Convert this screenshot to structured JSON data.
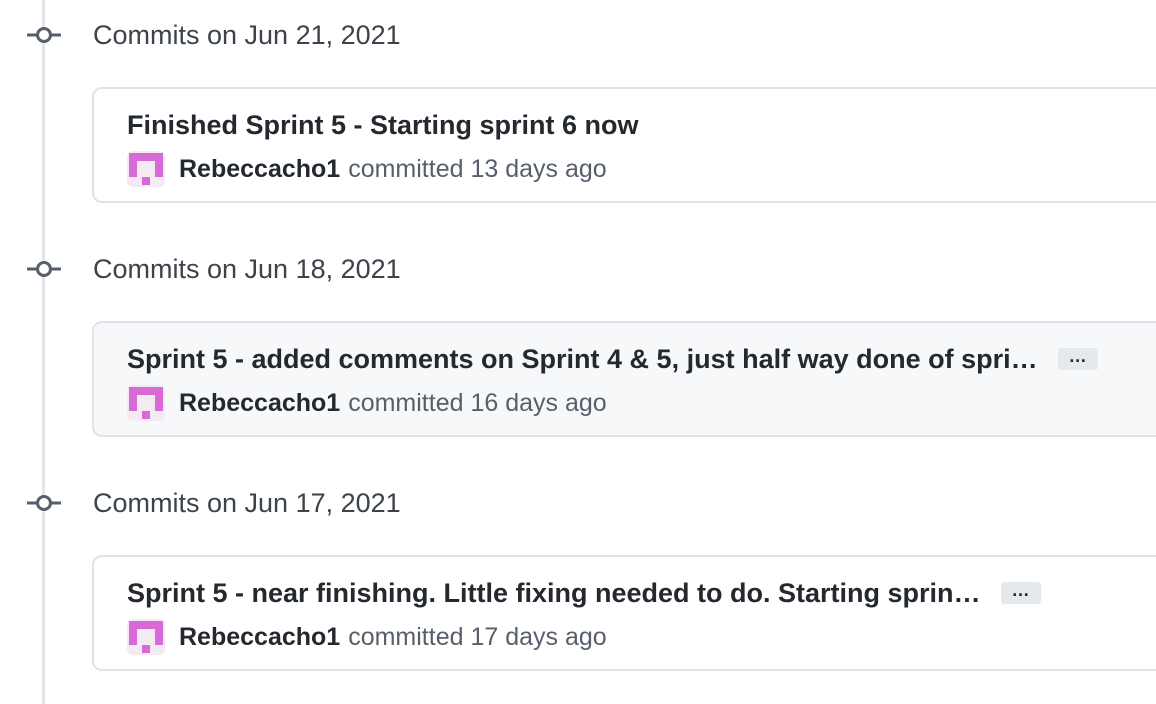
{
  "commit_groups": [
    {
      "date": "Commits on Jun 21, 2021",
      "commits": [
        {
          "title": "Finished Sprint 5 - Starting sprint 6 now",
          "has_ellipsis": false,
          "ellipsis_label": "",
          "author": "Rebeccacho1",
          "committed_text": "committed 13 days ago"
        }
      ]
    },
    {
      "date": "Commits on Jun 18, 2021",
      "commits": [
        {
          "title": "Sprint 5 - added comments on Sprint 4 & 5, just half way done of spri…",
          "has_ellipsis": true,
          "ellipsis_label": "…",
          "author": "Rebeccacho1",
          "committed_text": "committed 16 days ago"
        }
      ]
    },
    {
      "date": "Commits on Jun 17, 2021",
      "commits": [
        {
          "title": "Sprint 5 - near finishing. Little fixing needed to do. Starting sprin…",
          "has_ellipsis": true,
          "ellipsis_label": "…",
          "author": "Rebeccacho1",
          "committed_text": "committed 17 days ago"
        }
      ]
    }
  ],
  "colors": {
    "avatar": "#d86ad8",
    "timeline": "#e1e4e8",
    "border": "#dfe3e8"
  },
  "icons": {
    "commit_node": "git-commit-icon",
    "avatar": "identicon-avatar"
  }
}
